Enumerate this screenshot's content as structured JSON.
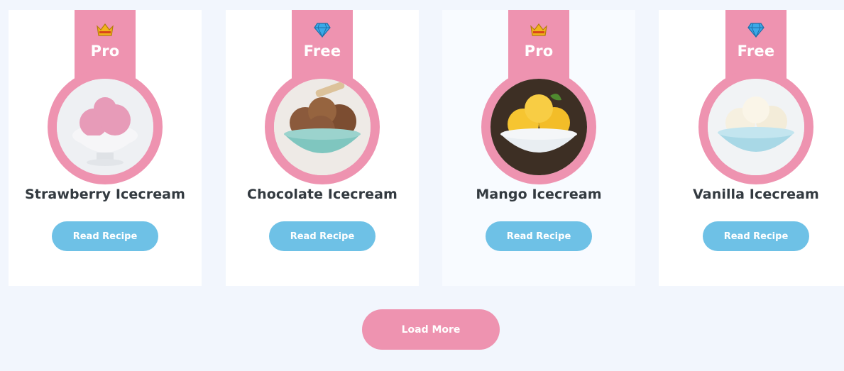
{
  "cards": [
    {
      "tier": "Pro",
      "emblem": "crown-icon",
      "title": "Strawberry Icecream",
      "button_label": "Read Recipe",
      "scoop_color": "#e79bb8",
      "bowl_color": "#f6f6f8"
    },
    {
      "tier": "Free",
      "emblem": "diamond-icon",
      "title": "Chocolate Icecream",
      "button_label": "Read Recipe",
      "scoop_color": "#8b5a3c",
      "bowl_color": "#7fc6bf"
    },
    {
      "tier": "Pro",
      "emblem": "crown-icon",
      "title": "Mango Icecream",
      "button_label": "Read Recipe",
      "scoop_color": "#f6c531",
      "bowl_color": "#e9eef2"
    },
    {
      "tier": "Free",
      "emblem": "diamond-icon",
      "title": "Vanilla Icecream",
      "button_label": "Read Recipe",
      "scoop_color": "#f6f0e0",
      "bowl_color": "#a8d8e6"
    }
  ],
  "load_more_label": "Load More",
  "colors": {
    "accent_pink": "#ee93b0",
    "button_blue": "#6ec1e6",
    "page_background": "#f2f6fd"
  }
}
